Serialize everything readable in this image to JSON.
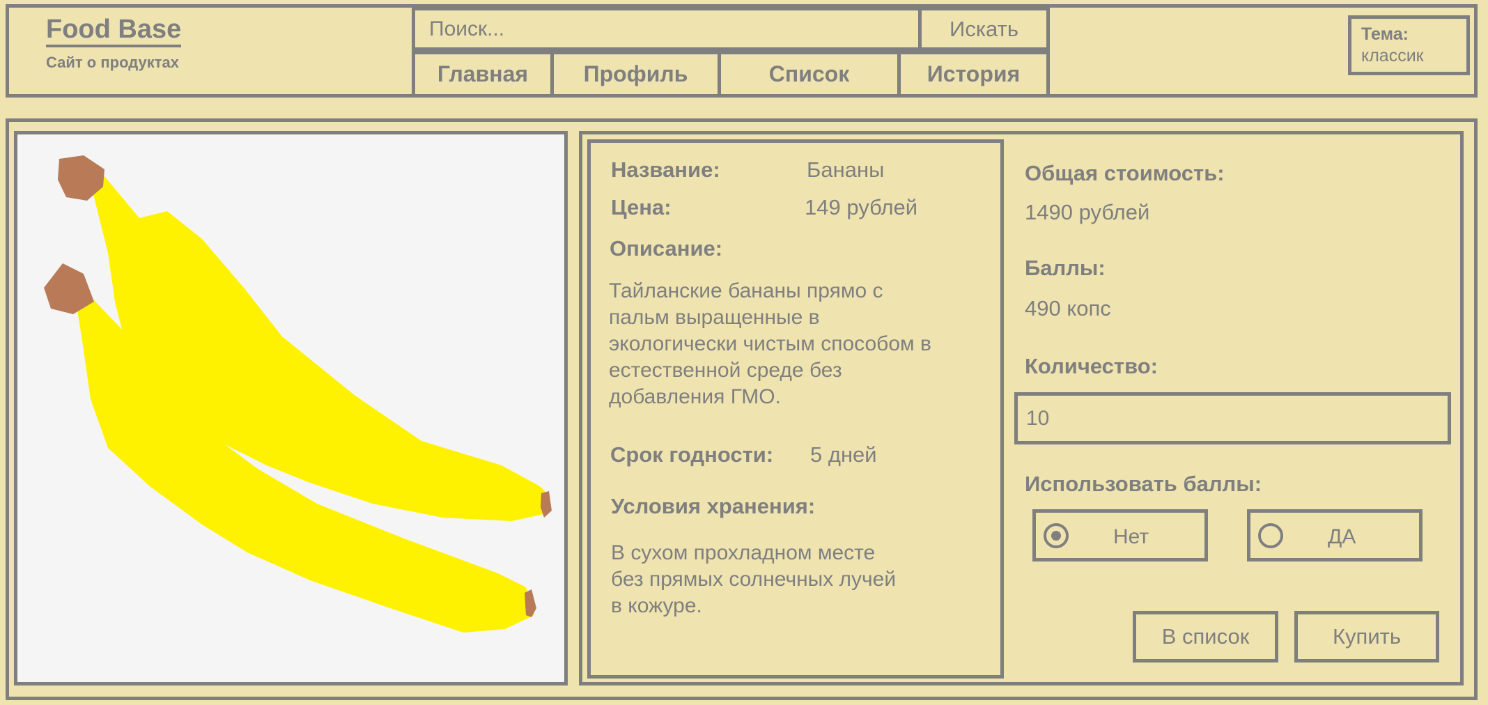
{
  "header": {
    "site_title": "Food Base",
    "site_subtitle": "Сайт о продуктах",
    "search": {
      "placeholder": "Поиск...",
      "button_label": "Искать"
    },
    "nav": [
      "Главная",
      "Профиль",
      "Список",
      "История"
    ],
    "theme": {
      "label": "Тема:",
      "value": "классик"
    }
  },
  "product": {
    "name_label": "Название:",
    "name": "Бананы",
    "price_label": "Цена:",
    "price": "149 рублей",
    "description_label": "Описание:",
    "description": "Тайланские бананы прямо с\nпальм выращенные в\nэкологически чистым способом в\nестественной среде без\nдобавления ГМО.",
    "shelf_life_label": "Срок годности:",
    "shelf_life": "5 дней",
    "storage_label": "Условия хранения:",
    "storage": "В сухом прохладном месте\nбез прямых солнечных лучей\nв кожуре."
  },
  "order": {
    "total_label": "Общая стоимость:",
    "total": "1490 рублей",
    "points_label": "Баллы:",
    "points": "490 копс",
    "quantity_label": "Количество:",
    "quantity": "10",
    "use_points_label": "Использовать баллы:",
    "use_points_options": [
      {
        "label": "Нет",
        "selected": true
      },
      {
        "label": "ДА",
        "selected": false
      }
    ],
    "add_to_list_label": "В список",
    "buy_label": "Купить"
  },
  "colors": {
    "background": "#efe4b0",
    "border_text": "#7f7f7f",
    "image_bg": "#f5f5f5",
    "banana_yellow": "#fff200",
    "banana_tip": "#b97a57"
  }
}
